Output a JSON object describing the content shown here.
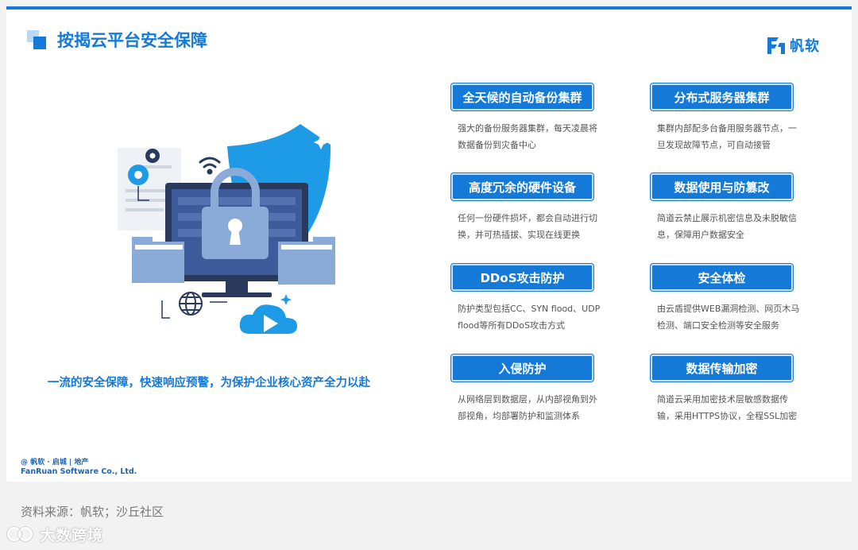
{
  "page": {
    "title": "按揭云平台安全保障",
    "tagline": "一流的安全保障，快速响应预警，为保护企业核心资产全力以赴"
  },
  "logo": {
    "text": "帆软",
    "icon": "fanruan-logo-icon"
  },
  "features": [
    {
      "title": "全天候的自动备份集群",
      "desc": "强大的备份服务器集群，每天凌晨将数据备份到灾备中心"
    },
    {
      "title": "分布式服务器集群",
      "desc": "集群内部配多台备用服务器节点，一旦发现故障节点，可自动接管"
    },
    {
      "title": "高度冗余的硬件设备",
      "desc": "任何一份硬件损坏，都会自动进行切换，并可热插拔、实现在线更换"
    },
    {
      "title": "数据使用与防篡改",
      "desc": "简道云禁止展示机密信息及未脱敏信息，保障用户数据安全"
    },
    {
      "title": "DDoS攻击防护",
      "desc": "防护类型包括CC、SYN flood、UDP flood等所有DDoS攻击方式"
    },
    {
      "title": "安全体检",
      "desc": "由云盾提供WEB漏洞检测、网页木马检测、端口安全检测等安全服务"
    },
    {
      "title": "入侵防护",
      "desc": "从网络层到数据层，从内部视角到外部视角，均部署防护和监测体系"
    },
    {
      "title": "数据传输加密",
      "desc": "简道云采用加密技术层敏感数据传输，采用HTTPS协议，全程SSL加密"
    }
  ],
  "footer": {
    "brand": "@ 帆软 · 启城 | 地产",
    "company": "FanRuan Software Co., Ltd."
  },
  "source": "资料来源：帆软；沙丘社区",
  "watermark": {
    "text": "大数跨境",
    "icon": "dashukuajing-logo-icon"
  },
  "colors": {
    "accent": "#1479d7",
    "light": "#bcd9f3",
    "text": "#555555"
  }
}
